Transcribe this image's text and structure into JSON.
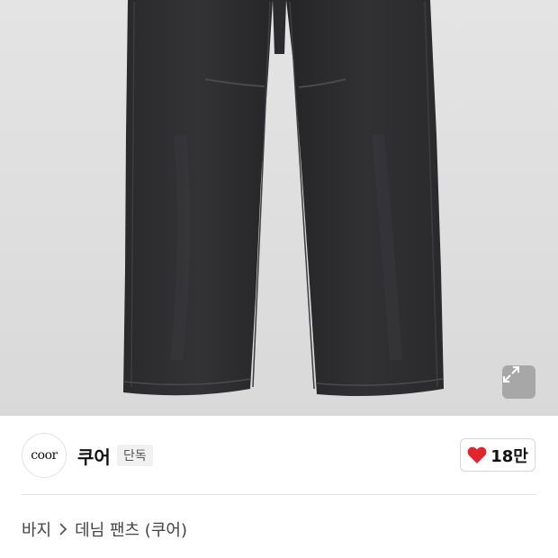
{
  "product_image": {
    "alt": "black denim wide pants",
    "expand_icon": "expand-icon"
  },
  "seller": {
    "logo_text": "coor",
    "name": "쿠어",
    "badge": "단독"
  },
  "like": {
    "icon": "heart-icon",
    "color": "#e0262b",
    "count": "18만"
  },
  "breadcrumb": {
    "category": "바지",
    "separator_icon": "chevron-right-icon",
    "current": "데님 팬츠 (쿠어)"
  }
}
